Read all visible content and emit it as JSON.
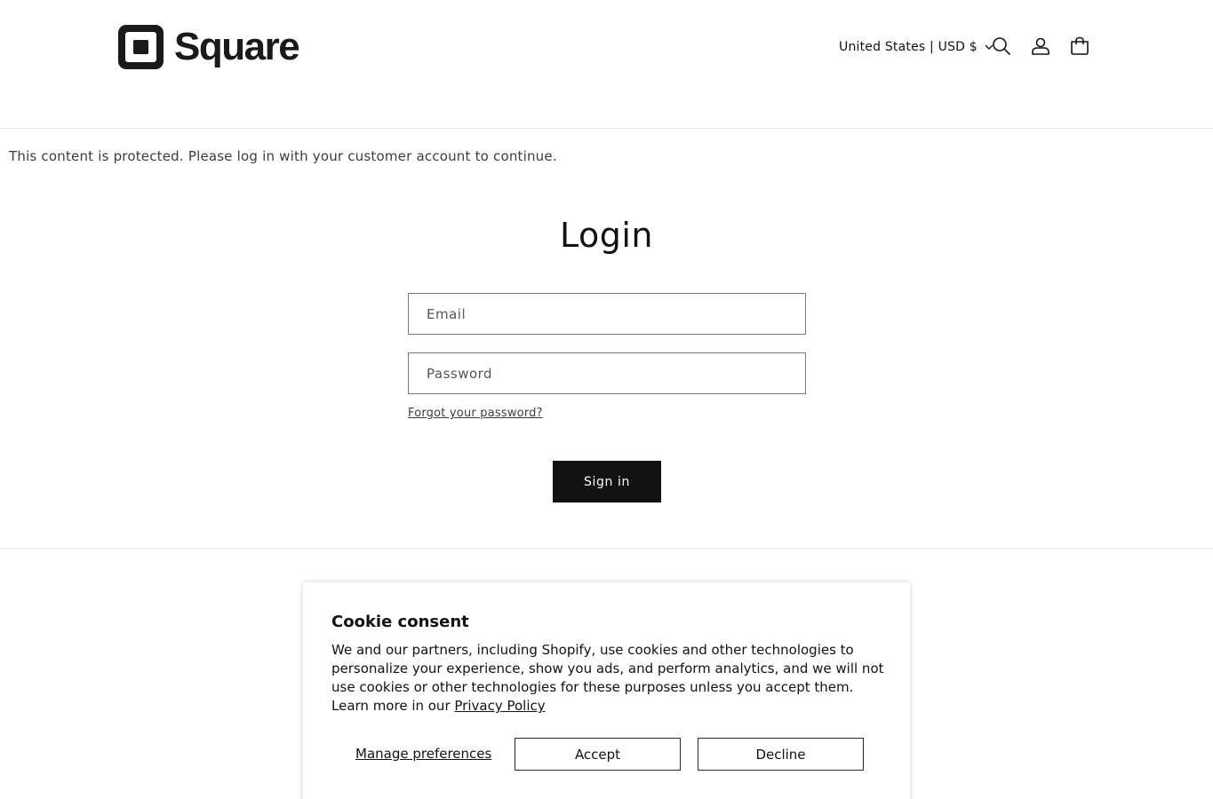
{
  "header": {
    "logo_text": "Square",
    "locale_label": "United States | USD $",
    "icons": [
      "search-icon",
      "account-icon",
      "cart-icon"
    ]
  },
  "notice": "This content is protected. Please log in with your customer account to continue.",
  "login": {
    "title": "Login",
    "email_placeholder": "Email",
    "password_placeholder": "Password",
    "forgot_label": "Forgot your password?",
    "signin_label": "Sign in"
  },
  "cookie": {
    "title": "Cookie consent",
    "text": "We and our partners, including Shopify, use cookies and other technologies to personalize your experience, show you ads, and perform analytics, and we will not use cookies or other technologies for these purposes unless you accept them. Learn more in our",
    "privacy_link": "Privacy Policy",
    "manage_label": "Manage preferences",
    "accept_label": "Accept",
    "decline_label": "Decline"
  },
  "colors": {
    "text": "#121212",
    "button_bg": "#121212",
    "border": "#7a7a7a"
  }
}
